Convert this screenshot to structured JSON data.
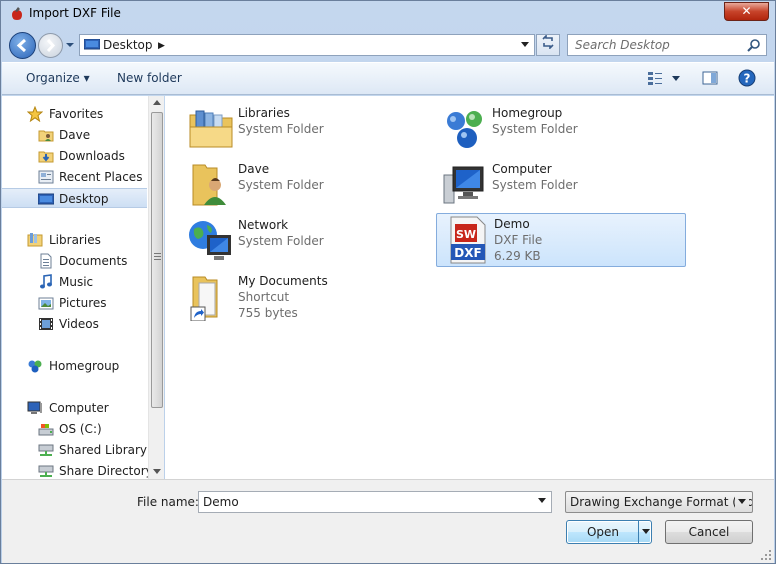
{
  "window": {
    "title": "Import DXF File",
    "close_label": "✕"
  },
  "navigation": {
    "address": "Desktop",
    "search_placeholder": "Search Desktop"
  },
  "toolbar": {
    "organize_label": "Organize ▾",
    "new_folder_label": "New folder"
  },
  "sidebar": {
    "favorites": {
      "label": "Favorites",
      "items": [
        {
          "label": "Dave",
          "icon": "user-folder-icon"
        },
        {
          "label": "Downloads",
          "icon": "downloads-icon"
        },
        {
          "label": "Recent Places",
          "icon": "recent-places-icon"
        },
        {
          "label": "Desktop",
          "icon": "desktop-icon",
          "selected": true
        }
      ]
    },
    "libraries": {
      "label": "Libraries",
      "items": [
        {
          "label": "Documents",
          "icon": "documents-icon"
        },
        {
          "label": "Music",
          "icon": "music-icon"
        },
        {
          "label": "Pictures",
          "icon": "pictures-icon"
        },
        {
          "label": "Videos",
          "icon": "videos-icon"
        }
      ]
    },
    "homegroup": {
      "label": "Homegroup"
    },
    "computer": {
      "label": "Computer",
      "items": [
        {
          "label": "OS (C:)",
          "icon": "drive-icon"
        },
        {
          "label": "Shared Library (\\\\",
          "icon": "network-drive-icon"
        },
        {
          "label": "Share Directory (\\",
          "icon": "network-drive-icon"
        }
      ]
    }
  },
  "files": [
    {
      "name": "Libraries",
      "sub1": "System Folder",
      "sub2": "",
      "icon": "libraries-folder-icon"
    },
    {
      "name": "Homegroup",
      "sub1": "System Folder",
      "sub2": "",
      "icon": "homegroup-icon"
    },
    {
      "name": "Dave",
      "sub1": "System Folder",
      "sub2": "",
      "icon": "user-folder-icon"
    },
    {
      "name": "Computer",
      "sub1": "System Folder",
      "sub2": "",
      "icon": "computer-icon"
    },
    {
      "name": "Network",
      "sub1": "System Folder",
      "sub2": "",
      "icon": "network-icon"
    },
    {
      "name": "Demo",
      "sub1": "DXF File",
      "sub2": "6.29 KB",
      "icon": "dxf-file-icon",
      "selected": true
    },
    {
      "name": "My Documents",
      "sub1": "Shortcut",
      "sub2": "755 bytes",
      "icon": "shortcut-folder-icon"
    }
  ],
  "footer": {
    "file_name_label": "File name:",
    "file_name_value": "Demo",
    "file_type_value": "Drawing Exchange Format (*.dx",
    "open_label": "Open",
    "cancel_label": "Cancel"
  }
}
